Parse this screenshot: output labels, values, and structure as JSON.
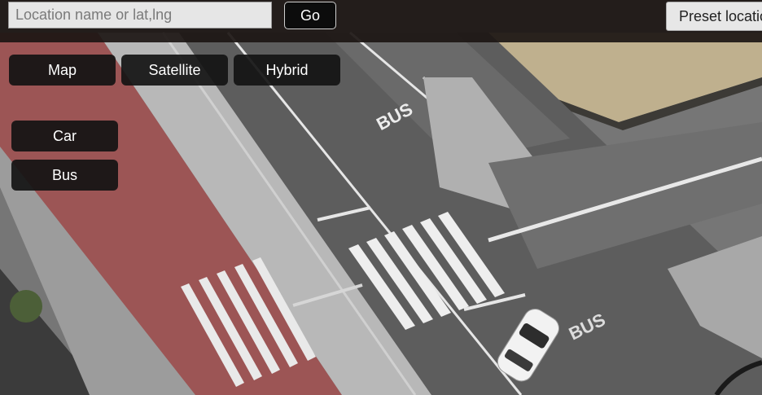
{
  "search": {
    "placeholder": "Location name or lat,lng",
    "value": ""
  },
  "go_label": "Go",
  "preset_label": "Preset locations",
  "map_types": [
    "Map",
    "Satellite",
    "Hybrid"
  ],
  "vehicles": [
    "Car",
    "Bus"
  ],
  "road_markings": {
    "bus_1": "BUS",
    "bus_2": "BUS"
  },
  "colors": {
    "bus_lane": "#9c5555",
    "asphalt": "#6c6c6c",
    "sidewalk": "#b4b4b4",
    "top_bar": "#1c1614"
  }
}
